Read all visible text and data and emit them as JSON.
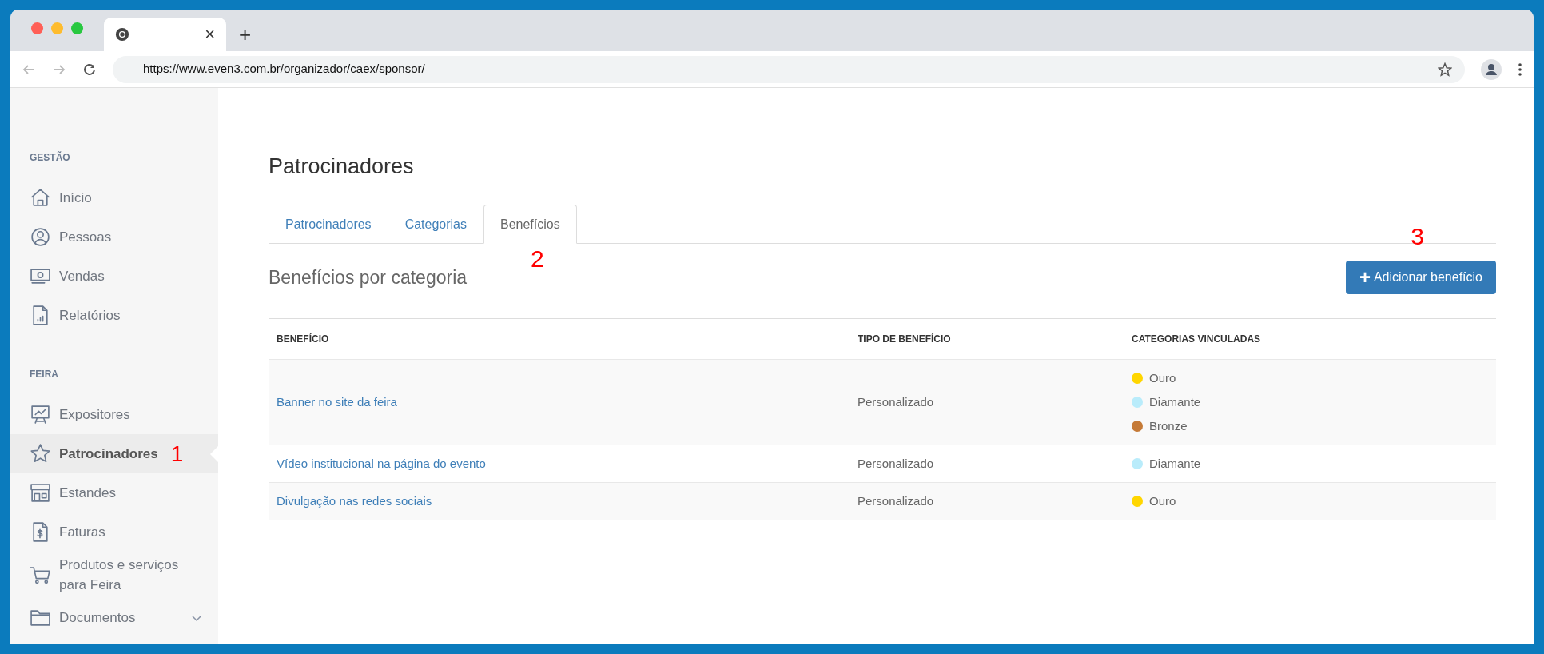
{
  "browser": {
    "url": "https://www.even3.com.br/organizador/caex/sponsor/",
    "new_tab": "+",
    "close_tab": "×"
  },
  "sidebar": {
    "sections": [
      {
        "heading": "GESTÃO",
        "items": [
          {
            "label": "Início",
            "selected": false
          },
          {
            "label": "Pessoas",
            "selected": false
          },
          {
            "label": "Vendas",
            "selected": false
          },
          {
            "label": "Relatórios",
            "selected": false
          }
        ]
      },
      {
        "heading": "FEIRA",
        "items": [
          {
            "label": "Expositores",
            "selected": false
          },
          {
            "label": "Patrocinadores",
            "selected": true,
            "annotation": "1"
          },
          {
            "label": "Estandes",
            "selected": false
          },
          {
            "label": "Faturas",
            "selected": false
          },
          {
            "label": "Produtos e serviços para Feira",
            "selected": false
          },
          {
            "label": "Documentos",
            "selected": false,
            "expandable": true
          }
        ]
      }
    ]
  },
  "page": {
    "title": "Patrocinadores",
    "tabs": [
      {
        "label": "Patrocinadores",
        "selected": false
      },
      {
        "label": "Categorias",
        "selected": false
      },
      {
        "label": "Benefícios",
        "selected": true,
        "annotation": "2"
      }
    ],
    "subtitle": "Benefícios por categoria",
    "add_button": {
      "icon": "+",
      "label": "Adicionar benefício",
      "annotation": "3"
    },
    "table": {
      "columns": [
        "BENEFÍCIO",
        "TIPO DE BENEFÍCIO",
        "CATEGORIAS VINCULADAS"
      ],
      "rows": [
        {
          "name": "Banner no site da feira",
          "type": "Personalizado",
          "categories": [
            {
              "label": "Ouro",
              "color": "#ffd600"
            },
            {
              "label": "Diamante",
              "color": "#b9ecfb"
            },
            {
              "label": "Bronze",
              "color": "#c57a37"
            }
          ]
        },
        {
          "name": "Vídeo institucional na página do evento",
          "type": "Personalizado",
          "categories": [
            {
              "label": "Diamante",
              "color": "#b9ecfb"
            }
          ]
        },
        {
          "name": "Divulgação nas redes sociais",
          "type": "Personalizado",
          "categories": [
            {
              "label": "Ouro",
              "color": "#ffd600"
            }
          ]
        }
      ]
    }
  }
}
